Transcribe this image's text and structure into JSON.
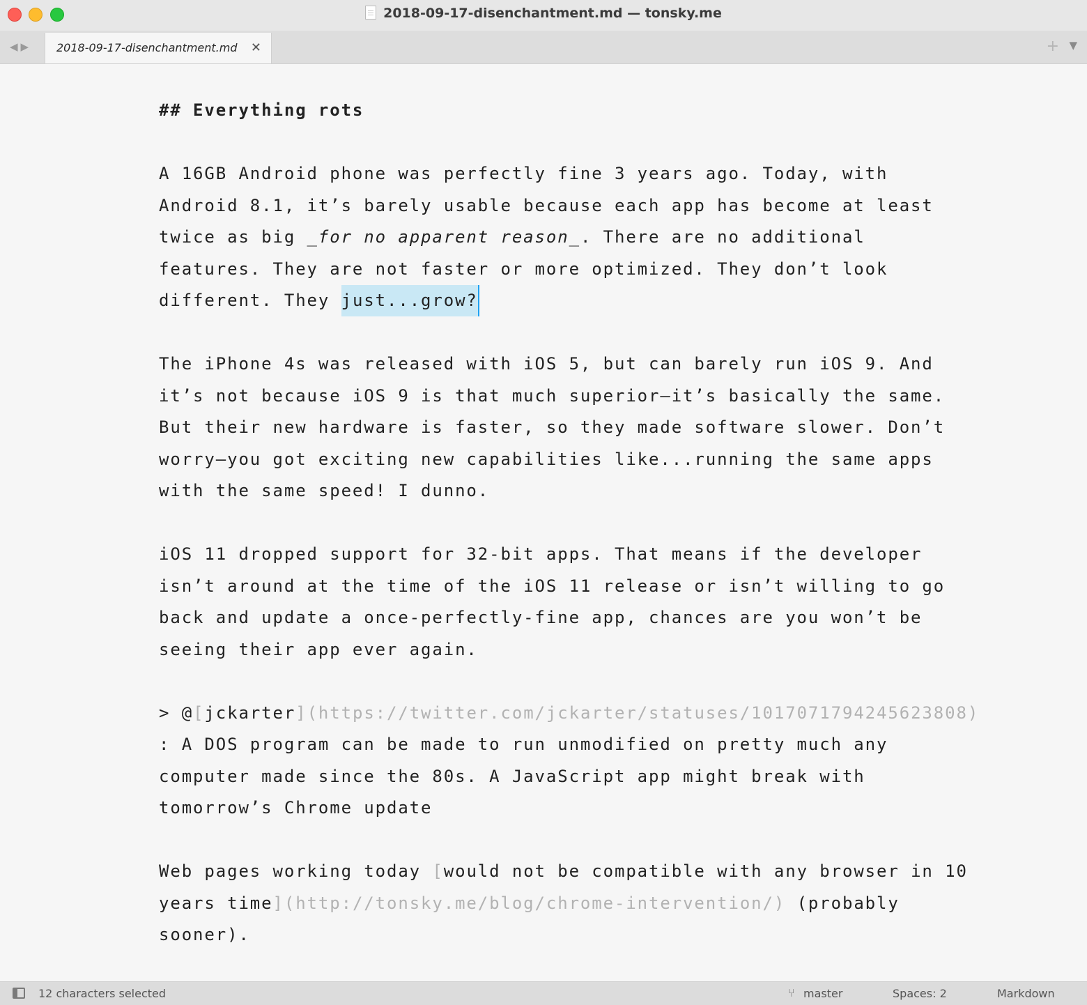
{
  "window": {
    "title": "2018-09-17-disenchantment.md — tonsky.me"
  },
  "tabs": [
    {
      "label": "2018-09-17-disenchantment.md",
      "close": "✕"
    }
  ],
  "tabbar": {
    "back": "◀",
    "forward": "▶",
    "new_tab": "+",
    "menu": "▼"
  },
  "editor": {
    "heading": "## Everything rots",
    "p1": {
      "l1": "A 16GB Android phone was perfectly fine 3 years ago. Today, with",
      "l2": "Android 8.1, it’s barely usable because each app has become at least",
      "l3a": "twice as big ",
      "l3em": "_for no apparent reason_",
      "l3b": ". There are no additional",
      "l4": "features. They are not faster or more optimized. They don’t look",
      "l5a": "different. They ",
      "l5sel": "just...grow?"
    },
    "p2": {
      "l1": "The iPhone 4s was released with iOS 5, but can barely run iOS 9. And",
      "l2": "it’s not because iOS 9 is that much superior—it’s basically the same.",
      "l3": "But their new hardware is faster, so they made software slower. Don’t",
      "l4": "worry—you got exciting new capabilities like...running the same apps",
      "l5": "with the same speed! I dunno."
    },
    "p3": {
      "l1": "iOS 11 dropped support for 32-bit apps. That means if the developer",
      "l2": "isn’t around at the time of the iOS 11 release or isn’t willing to go",
      "l3": "back and update a once-perfectly-fine app, chances are you won’t be",
      "l4": "seeing their app ever again."
    },
    "quote": {
      "prefix": "> @",
      "bracket_open": "[",
      "link_text": "jckarter",
      "link_url": "](https://twitter.com/jckarter/statuses/1017071794245623808)",
      "l2": ": A DOS program can be made to run unmodified on pretty much any",
      "l3": "computer made since the 80s. A JavaScript app might break with",
      "l4": "tomorrow’s Chrome update"
    },
    "p4": {
      "l1a": "Web pages working today ",
      "l1b": "[",
      "l1c": "would not be compatible with any browser in 10",
      "l2a": "years time",
      "l2b": "](http://tonsky.me/blog/chrome-intervention/)",
      "l2c": " (probably",
      "l3": "sooner)."
    }
  },
  "statusbar": {
    "selection": "12 characters selected",
    "branch": "master",
    "indent": "Spaces: 2",
    "syntax": "Markdown"
  }
}
